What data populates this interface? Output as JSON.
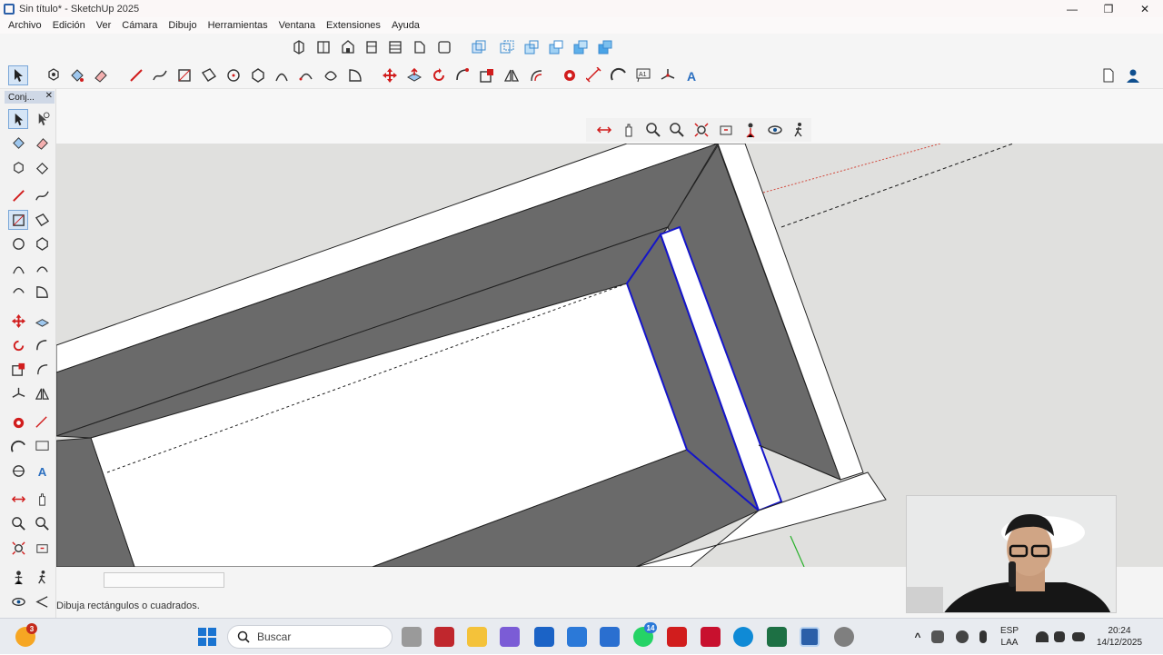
{
  "window": {
    "title": "Sin título* - SketchUp 2025",
    "minimize": "—",
    "maximize": "❐",
    "close": "✕"
  },
  "menu": [
    "Archivo",
    "Edición",
    "Ver",
    "Cámara",
    "Dibujo",
    "Herramientas",
    "Ventana",
    "Extensiones",
    "Ayuda"
  ],
  "left_panel": {
    "title": "Conj...",
    "close": "✕"
  },
  "status": {
    "hint": "Dibuja rectángulos o cuadrados.",
    "vcb_value": ""
  },
  "taskbar": {
    "search_placeholder": "Buscar",
    "language": "ESP",
    "region": "LAA",
    "time": "20:24",
    "date": "14/12/2025",
    "whatsapp_badge": "14",
    "notification_badge": "3"
  },
  "colors": {
    "accent": "#2b5fa8",
    "selection": "#1515c8",
    "face_dark": "#6a6a6a",
    "face_light": "#ffffff",
    "ground": "#e0e0de",
    "red_icon": "#d11d1d"
  }
}
